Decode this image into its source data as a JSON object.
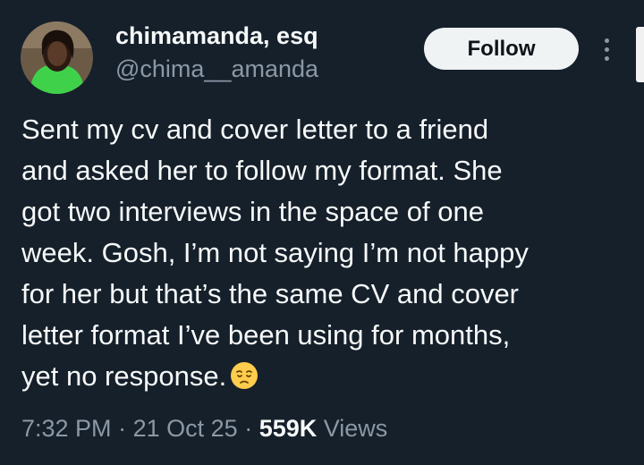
{
  "author": {
    "display_name": "chimamanda, esq",
    "handle": "@chima__amanda"
  },
  "actions": {
    "follow_label": "Follow",
    "more_icon": "more-vertical-icon"
  },
  "tweet": {
    "lines": [
      "Sent my cv and cover letter to a friend",
      "and asked her to follow my format. She",
      "got two interviews in the space of one",
      "week. Gosh, I’m not saying I’m not happy",
      "for her but that’s the same CV and cover",
      "letter format I’ve been using for months,",
      "yet no response."
    ],
    "emoji": "pensive-face"
  },
  "meta": {
    "time": "7:32 PM",
    "separator": "·",
    "date": "21 Oct 25",
    "views_count": "559K",
    "views_label": "Views"
  },
  "colors": {
    "background": "#15202b",
    "text_primary": "#f7f9f9",
    "text_secondary": "#8b98a5",
    "follow_button_bg": "#eff3f4",
    "follow_button_text": "#0f1419"
  }
}
